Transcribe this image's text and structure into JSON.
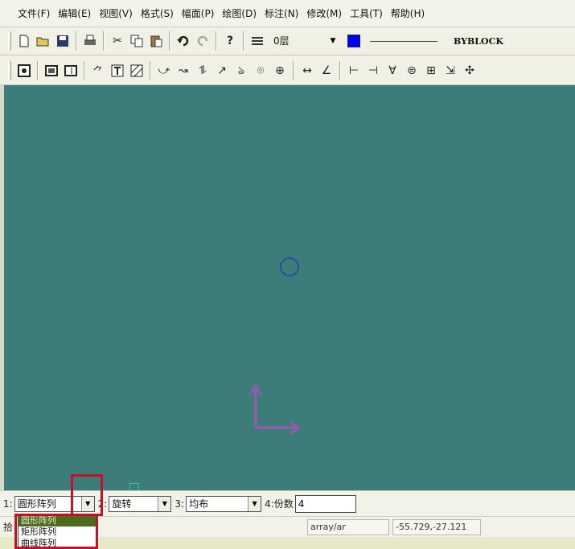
{
  "menu": [
    "文件(F)",
    "编辑(E)",
    "视图(V)",
    "格式(S)",
    "幅面(P)",
    "绘图(D)",
    "标注(N)",
    "修改(M)",
    "工具(T)",
    "帮助(H)"
  ],
  "layer": {
    "name": "0层",
    "color": "#0000ff"
  },
  "linetype_label": "BYBLOCK",
  "toolbar1_icons": [
    "new-file-icon",
    "open-folder-icon",
    "save-icon",
    "print-icon",
    "cut-icon",
    "copy-icon",
    "paste-icon",
    "undo-icon",
    "redo-icon",
    "help-icon",
    "layer-manager-icon"
  ],
  "toolbar2_icons": [
    "zoom-window-icon",
    "zoom-extents-icon",
    "zoom-previous-icon",
    "intersect-icon",
    "text-icon",
    "hatch-icon",
    "line-icon",
    "arc-icon",
    "spline-icon",
    "arrow-icon",
    "polyline-icon",
    "symbol-icon",
    "center-mark-icon",
    "linear-dimension-icon",
    "angle-dimension-icon",
    "trim-icon",
    "extend-icon",
    "break-icon",
    "fillet-icon",
    "chamfer-icon",
    "offset-icon",
    "explode-icon"
  ],
  "params": {
    "p1_label": "1:",
    "p1_value": "圆形阵列",
    "p2_label": "2:",
    "p2_value": "旋转",
    "p3_label": "3:",
    "p3_value": "均布",
    "p4_label": "4:份数",
    "p4_value": "4"
  },
  "dropdown_options": [
    "圆形阵列",
    "矩形阵列",
    "曲线阵列"
  ],
  "status": {
    "prefix": "拾",
    "command": "array/ar",
    "coordinates": "-55.729,-27.121"
  },
  "colors": {
    "canvas": "#3c7c79",
    "highlight": "#c1122a",
    "ucs": "#8a5fa6",
    "circle": "#2a4fa0"
  }
}
